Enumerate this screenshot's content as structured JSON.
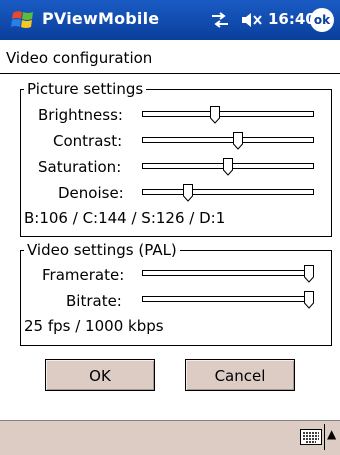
{
  "titlebar": {
    "app_title": "PViewMobile",
    "time": "16:40",
    "ok_label": "ok"
  },
  "page_title": "Video configuration",
  "picture_settings": {
    "legend": "Picture settings",
    "sliders": [
      {
        "label": "Brightness:",
        "level": 0.42
      },
      {
        "label": "Contrast:",
        "level": 0.56
      },
      {
        "label": "Saturation:",
        "level": 0.5
      },
      {
        "label": "Denoise:",
        "level": 0.25
      }
    ],
    "summary": "B:106 / C:144 / S:126 / D:1"
  },
  "video_settings": {
    "legend": "Video settings (PAL)",
    "sliders": [
      {
        "label": "Framerate:",
        "level": 1.0
      },
      {
        "label": "Bitrate:",
        "level": 1.0
      }
    ],
    "summary": "25 fps / 1000 kbps"
  },
  "buttons": {
    "ok": "OK",
    "cancel": "Cancel"
  },
  "icons": [
    "windows-start-icon",
    "connectivity-icon",
    "volume-icon",
    "keyboard-icon"
  ],
  "colors": {
    "titlebar": "#0a3f9c",
    "button_face": "#dcccc4"
  }
}
